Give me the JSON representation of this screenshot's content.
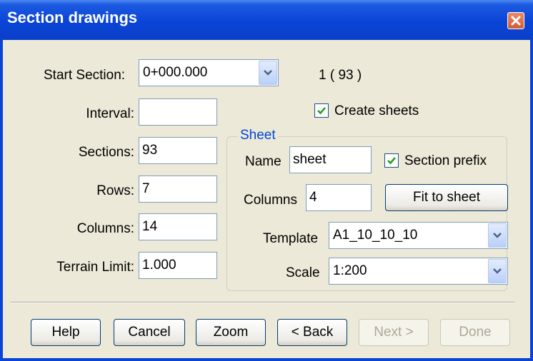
{
  "window": {
    "title": "Section drawings"
  },
  "form": {
    "start_section": {
      "label": "Start Section:",
      "value": "0+000.000"
    },
    "section_count": "1 ( 93 )",
    "create_sheets": {
      "label": "Create sheets",
      "checked": true
    },
    "interval": {
      "label": "Interval:",
      "value": ""
    },
    "sections": {
      "label": "Sections:",
      "value": "93"
    },
    "rows": {
      "label": "Rows:",
      "value": "7"
    },
    "columns": {
      "label": "Columns:",
      "value": "14"
    },
    "terrain_limit": {
      "label": "Terrain Limit:",
      "value": "1.000"
    }
  },
  "sheet": {
    "group_label": "Sheet",
    "name": {
      "label": "Name",
      "value": "sheet"
    },
    "section_prefix": {
      "label": "Section prefix",
      "checked": true
    },
    "columns": {
      "label": "Columns",
      "value": "4"
    },
    "fit_button": "Fit to sheet",
    "template": {
      "label": "Template",
      "value": "A1_10_10_10"
    },
    "scale": {
      "label": "Scale",
      "value": "1:200"
    }
  },
  "buttons": {
    "help": "Help",
    "cancel": "Cancel",
    "zoom": "Zoom",
    "back": "< Back",
    "next": "Next >",
    "done": "Done"
  },
  "colors": {
    "titlebar": "#0a44d6",
    "dialog_bg": "#ece9d8",
    "group_title": "#0046d5",
    "check": "#21a121"
  },
  "icons": {
    "close": "close-icon",
    "dropdown": "chevron-down-icon",
    "check": "checkmark-icon"
  }
}
